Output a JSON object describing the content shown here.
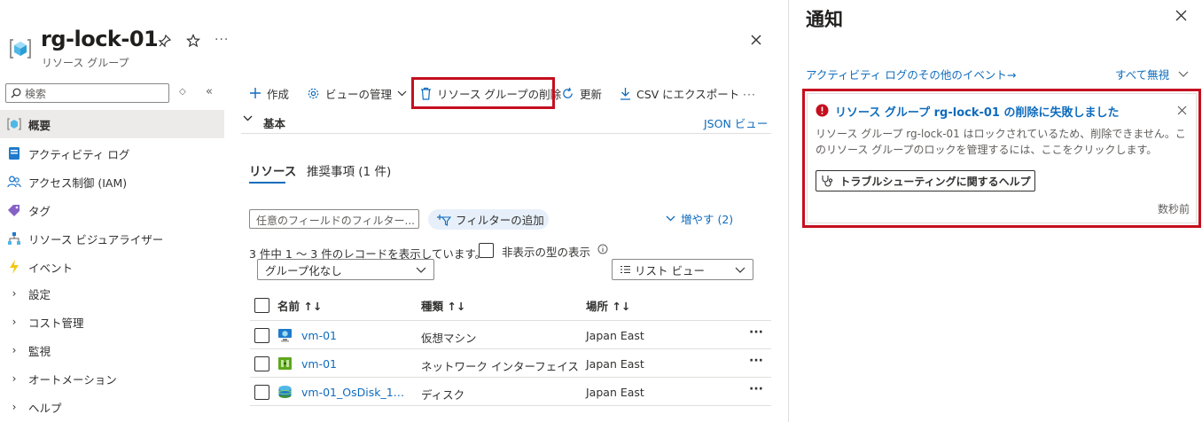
{
  "header": {
    "title": "rg-lock-01",
    "subtitle": "リソース グループ",
    "more": "···"
  },
  "sidebar": {
    "search_placeholder": "検索",
    "items": [
      {
        "label": "概要",
        "icon": "resource-group-icon",
        "active": true
      },
      {
        "label": "アクティビティ ログ",
        "icon": "activity-log-icon"
      },
      {
        "label": "アクセス制御 (IAM)",
        "icon": "iam-icon"
      },
      {
        "label": "タグ",
        "icon": "tag-icon"
      },
      {
        "label": "リソース ビジュアライザー",
        "icon": "visualizer-icon"
      },
      {
        "label": "イベント",
        "icon": "lightning-icon"
      },
      {
        "label": "設定",
        "expandable": true
      },
      {
        "label": "コスト管理",
        "expandable": true
      },
      {
        "label": "監視",
        "expandable": true
      },
      {
        "label": "オートメーション",
        "expandable": true
      },
      {
        "label": "ヘルプ",
        "expandable": true
      }
    ]
  },
  "toolbar": {
    "create": "作成",
    "manage_view": "ビューの管理",
    "delete_rg": "リソース グループの削除",
    "refresh": "更新",
    "export_csv": "CSV にエクスポート",
    "more": "···"
  },
  "essentials": {
    "label": "基本",
    "json_view": "JSON ビュー"
  },
  "tabs": {
    "resources": "リソース",
    "recommendations": "推奨事項 (1 件)"
  },
  "filters": {
    "filter_placeholder": "任意のフィールドのフィルター...",
    "add_filter": "フィルターの追加",
    "expand": "増やす (2)",
    "record_count": "3 件中 1 ～ 3 件のレコードを表示しています。",
    "show_hidden_types": "非表示の型の表示",
    "group_by": "グループ化なし",
    "view_mode": "リスト ビュー"
  },
  "table": {
    "columns": [
      "名前 ↑↓",
      "種類 ↑↓",
      "場所 ↑↓"
    ],
    "rows": [
      {
        "name": "vm-01",
        "type": "仮想マシン",
        "location": "Japan East",
        "icon": "virtual-machine-icon"
      },
      {
        "name": "vm-01",
        "type": "ネットワーク インターフェイス",
        "location": "Japan East",
        "icon": "network-interface-icon"
      },
      {
        "name": "vm-01_OsDisk_1…",
        "type": "ディスク",
        "location": "Japan East",
        "icon": "disk-icon"
      }
    ],
    "row_more": "···"
  },
  "notifications": {
    "title": "通知",
    "activity_link": "アクティビティ ログのその他のイベント→",
    "dismiss_all": "すべて無視",
    "card": {
      "heading": "リソース グループ rg-lock-01 の削除に失敗しました",
      "body": "リソース グループ rg-lock-01 はロックされているため、削除できません。このリソース グループのロックを管理するには、ここをクリックします。",
      "help_button": "トラブルシューティングに関するヘルプ",
      "time": "数秒前"
    }
  },
  "colors": {
    "accent": "#0f6cbd",
    "highlight": "#c50f1f",
    "error": "#c50f1f"
  }
}
